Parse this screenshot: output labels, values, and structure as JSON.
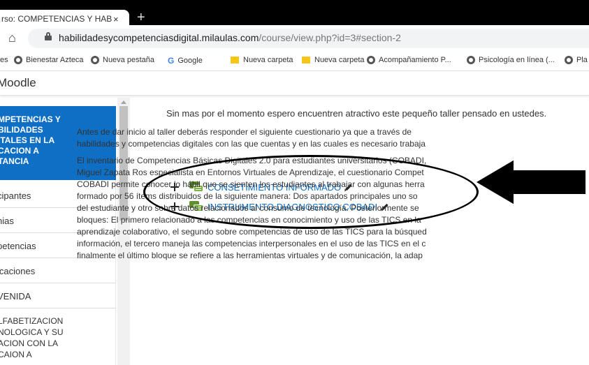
{
  "browser": {
    "tab_title": "rso: COMPETENCIAS Y HABILIDA",
    "tab_close": "×",
    "new_tab": "+",
    "url_host": "habilidadesycompetenciasdigital.milaulas.com",
    "url_path": "/course/view.php?id=3#section-2"
  },
  "bookmarks": [
    {
      "label": "es",
      "icon": "none"
    },
    {
      "label": "Bienestar Azteca",
      "icon": "globe-icon"
    },
    {
      "label": "Nueva pestaña",
      "icon": "globe-icon"
    },
    {
      "label": "Google",
      "icon": "google-icon"
    },
    {
      "label": "Nueva carpeta",
      "icon": "folder-icon"
    },
    {
      "label": "Nueva carpeta",
      "icon": "folder-icon"
    },
    {
      "label": "Acompañamiento P...",
      "icon": "globe-icon"
    },
    {
      "label": "Psicología en línea (...",
      "icon": "globe-icon"
    },
    {
      "label": "Pla",
      "icon": "globe-icon"
    }
  ],
  "moodle": {
    "brand": "Moodle"
  },
  "sidebar": {
    "course_title_lines": [
      "MPETENCIAS Y",
      "BILIDADES",
      "ITALES EN LA",
      "CACION A",
      "TANCIA"
    ],
    "items": [
      "cipantes",
      "nias",
      "petencias",
      "icaciones",
      "VENIDA"
    ],
    "multi_lines": [
      "LFABETIZACION",
      "NOLOGICA Y SU",
      "ACION CON LA",
      "CAION A"
    ]
  },
  "main": {
    "intro": "Sin mas por el momento espero encuentren atractivo este  pequeño taller pensado en ustedes.",
    "activities": [
      {
        "label": "CONSETIMIENTO INFORMADO"
      },
      {
        "label": "INSTRUMENTO DIAGNOSTICO COBADI"
      }
    ],
    "description": {
      "para1": [
        "Antes de  dar  inicio al taller deberás  responder el siguiente cuestionario ya que a  través de",
        "habilidades y competencias digitales con las que cuentas y en las cuales es necesario trabaja"
      ],
      "para2": [
        "El inventario de Competencias Básicas Digitales 2.0 para estudiantes universitarios (COBADI,",
        "Miguel Zapata Ros especialista en Entornos Virtuales de Aprendizaje, el cuestionario Compet",
        "COBADI permite conocer lo hábil que se sienten los estudiantes al trabajar con algunas herra",
        "formado por 56 ítems distribuidos de la siguiente manera: Dos apartados principales uno so",
        "del estudiante y otro sobre datos relacionados al consumo de tecnología. Posteriormente se",
        "bloques: El primero relacionado a las competencias en conocimiento y uso de las TICS en la",
        "aprendizaje colaborativo, el segundo sobre competencias de uso de las TICS para la búsqued",
        "información, el tercero maneja las competencias interpersonales en el uso de las TICS en el c",
        "finalmente el último bloque se refiere a las herramientas virtuales y de comunicación, la adap"
      ]
    }
  },
  "colors": {
    "accent": "#0f6fc5",
    "link": "#0f6fc5",
    "forum_green": "#7cb342"
  }
}
